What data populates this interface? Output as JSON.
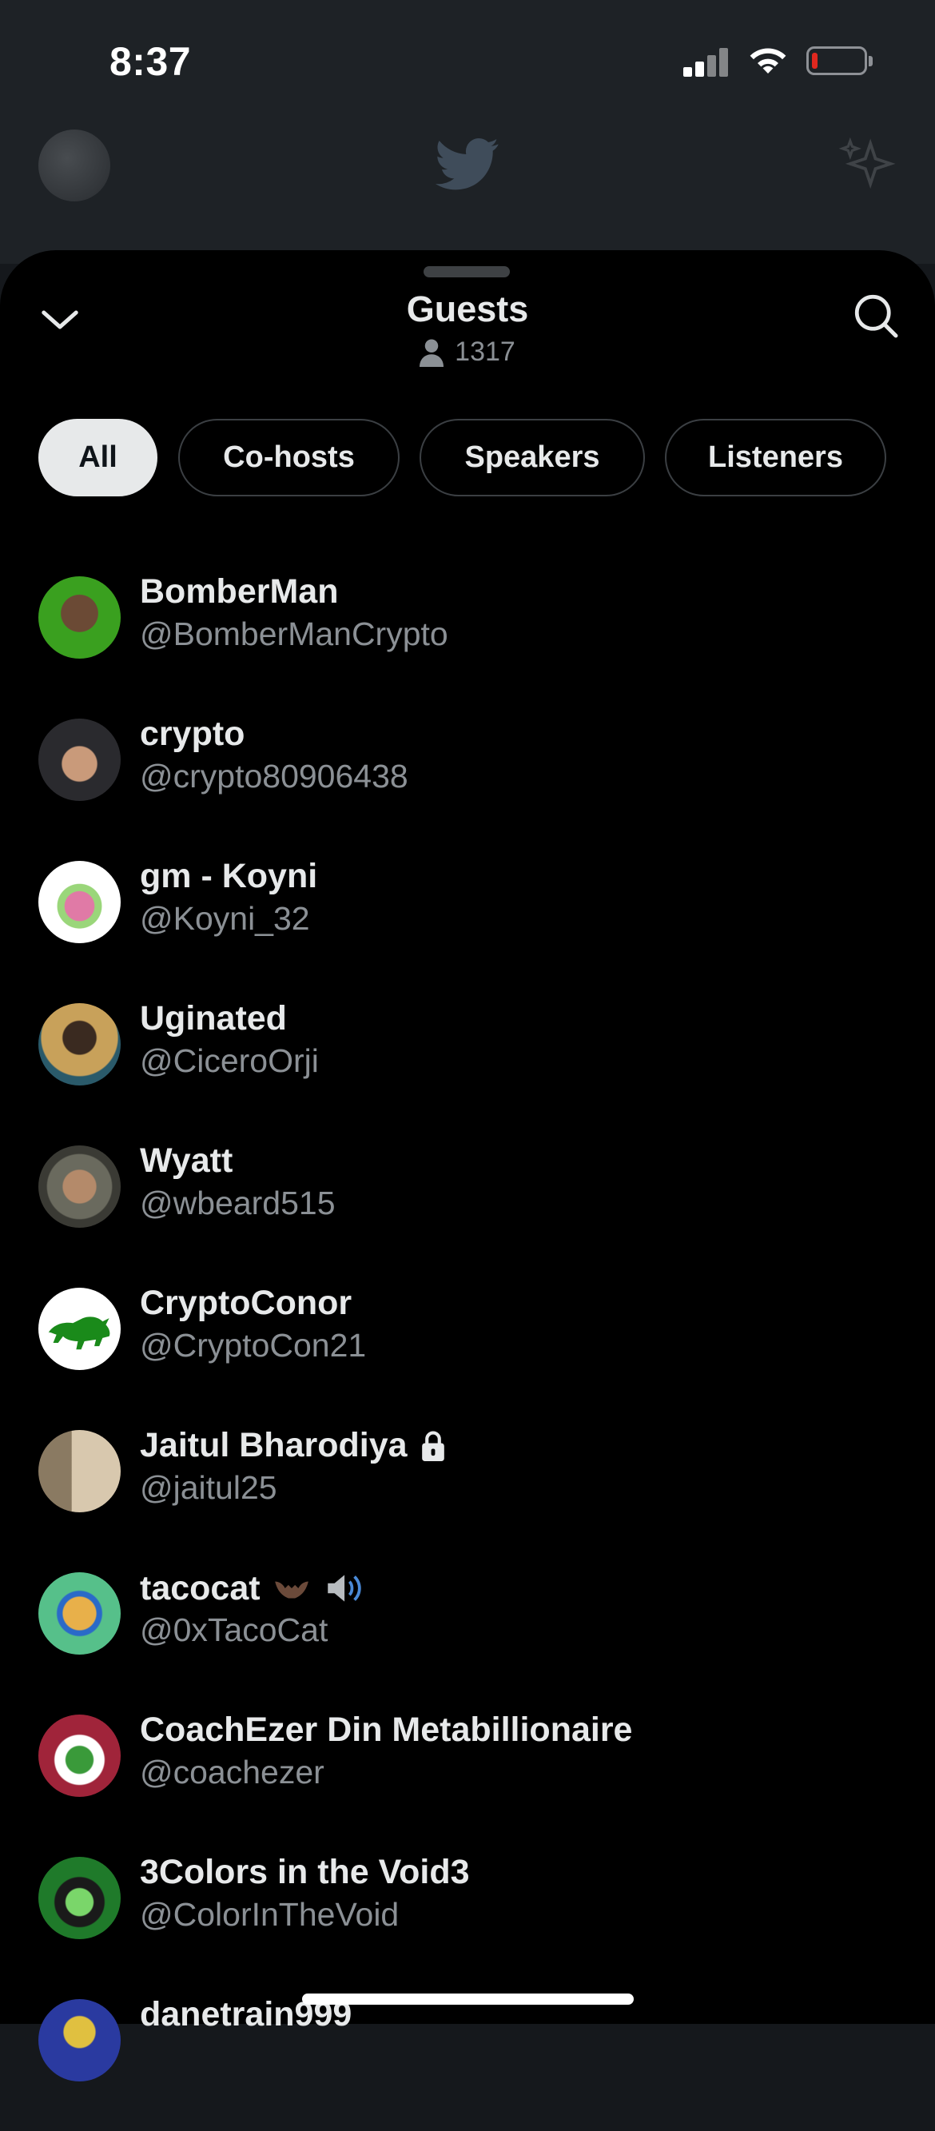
{
  "status_bar": {
    "time": "8:37"
  },
  "header": {
    "title": "Guests",
    "count": "1317"
  },
  "filters": [
    {
      "label": "All",
      "active": true
    },
    {
      "label": "Co-hosts",
      "active": false
    },
    {
      "label": "Speakers",
      "active": false
    },
    {
      "label": "Listeners",
      "active": false
    }
  ],
  "guests": [
    {
      "name": "BomberMan",
      "handle": "@BomberManCrypto",
      "avatar_color": "#3aa01f"
    },
    {
      "name": "crypto",
      "handle": "@crypto80906438",
      "avatar_color": "#2a2a2e"
    },
    {
      "name": "gm - Koyni",
      "handle": "@Koyni_32",
      "avatar_color": "#ffffff"
    },
    {
      "name": "Uginated",
      "handle": "@CiceroOrji",
      "avatar_color": "#c8a15a"
    },
    {
      "name": "Wyatt",
      "handle": "@wbeard515",
      "avatar_color": "#5a5a52"
    },
    {
      "name": "CryptoConor",
      "handle": "@CryptoCon21",
      "avatar_color": "#ffffff"
    },
    {
      "name": "Jaitul Bharodiya",
      "handle": "@jaitul25",
      "avatar_color": "#b59c7a",
      "badge": "lock-icon"
    },
    {
      "name": "tacocat",
      "handle": "@0xTacoCat",
      "avatar_color": "#56c08a",
      "badge": "bat-and-speaker-emoji"
    },
    {
      "name": "CoachEzer Din Metabillionaire",
      "handle": "@coachezer",
      "avatar_color": "#a0243a"
    },
    {
      "name": "3Colors in the Void3",
      "handle": "@ColorInTheVoid",
      "avatar_color": "#1f7a2a"
    },
    {
      "name": "danetrain999",
      "handle": "",
      "avatar_color": "#2a3aa0"
    }
  ]
}
